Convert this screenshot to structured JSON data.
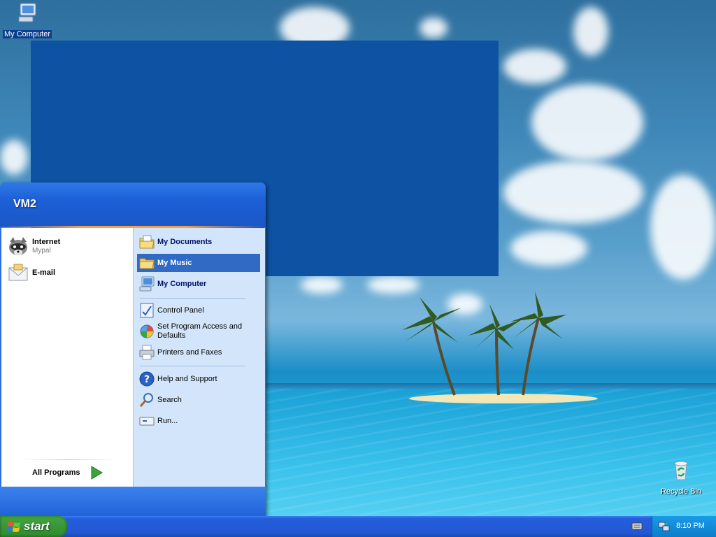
{
  "desktop": {
    "icons": [
      {
        "label": "My Computer"
      },
      {
        "label": "Recycle Bin"
      }
    ]
  },
  "start_menu": {
    "user_name": "VM2",
    "pinned": [
      {
        "title": "Internet",
        "subtitle": "Mypal",
        "icon": "raccoon-browser-icon"
      },
      {
        "title": "E-mail",
        "subtitle": "",
        "icon": "email-icon"
      }
    ],
    "all_programs_label": "All Programs",
    "places": [
      {
        "label": "My Documents",
        "icon": "my-documents-icon",
        "bold": true
      },
      {
        "label": "My Music",
        "icon": "my-music-icon",
        "bold": true,
        "highlighted": true
      },
      {
        "label": "My Computer",
        "icon": "my-computer-icon",
        "bold": true
      }
    ],
    "settings": [
      {
        "label": "Control Panel",
        "icon": "control-panel-icon"
      },
      {
        "label": "Set Program Access and Defaults",
        "icon": "program-access-icon"
      },
      {
        "label": "Printers and Faxes",
        "icon": "printer-icon"
      }
    ],
    "help": [
      {
        "label": "Help and Support",
        "icon": "help-icon"
      },
      {
        "label": "Search",
        "icon": "search-icon"
      },
      {
        "label": "Run...",
        "icon": "run-icon"
      }
    ]
  },
  "taskbar": {
    "start_label": "start",
    "clock": "8:10 PM"
  },
  "colors": {
    "taskbar_blue": "#245edb",
    "start_green": "#3c9a3c",
    "highlight": "#316ac5",
    "blank_window": "#0d52a3"
  }
}
